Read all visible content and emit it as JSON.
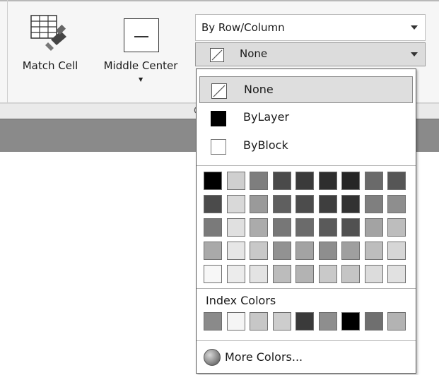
{
  "ribbon": {
    "match_cell_label": "Match Cell",
    "middle_center_label": "Middle Center",
    "group_label_fragment": "C",
    "row_column_value": "By Row/Column",
    "fill_value": "None"
  },
  "dropdown": {
    "items": [
      {
        "label": "None"
      },
      {
        "label": "ByLayer"
      },
      {
        "label": "ByBlock"
      }
    ],
    "palette_rows": [
      [
        "#000000",
        "#cfcfcf",
        "#7e7e7e",
        "#4a4a4a",
        "#3a3a3a",
        "#2e2e2e",
        "#262626",
        "#6a6a6a",
        "#565656"
      ],
      [
        "#4b4b4b",
        "#d9d9d9",
        "#9a9a9a",
        "#5f5f5f",
        "#4c4c4c",
        "#3e3e3e",
        "#323232",
        "#7f7f7f",
        "#8e8e8e"
      ],
      [
        "#7a7a7a",
        "#e0e0e0",
        "#ababab",
        "#777777",
        "#6b6b6b",
        "#5a5a5a",
        "#515151",
        "#a3a3a3",
        "#bdbdbd"
      ],
      [
        "#a9a9a9",
        "#e6e6e6",
        "#c8c8c8",
        "#929292",
        "#a3a3a3",
        "#8e8e8e",
        "#9f9f9f",
        "#bdbdbd",
        "#d6d6d6"
      ],
      [
        "#f7f7f7",
        "#ececec",
        "#e3e3e3",
        "#bcbcbc",
        "#b3b3b3",
        "#c9c9c9",
        "#c5c5c5",
        "#dcdcdc",
        "#e1e1e1"
      ]
    ],
    "index_colors_label": "Index Colors",
    "index_colors": [
      "#8a8a8a",
      "#f5f5f5",
      "#c7c7c7",
      "#cdcdcd",
      "#3a3a3a",
      "#8e8e8e",
      "#000000",
      "#6f6f6f",
      "#b3b3b3"
    ],
    "more_colors_label": "More Colors..."
  }
}
